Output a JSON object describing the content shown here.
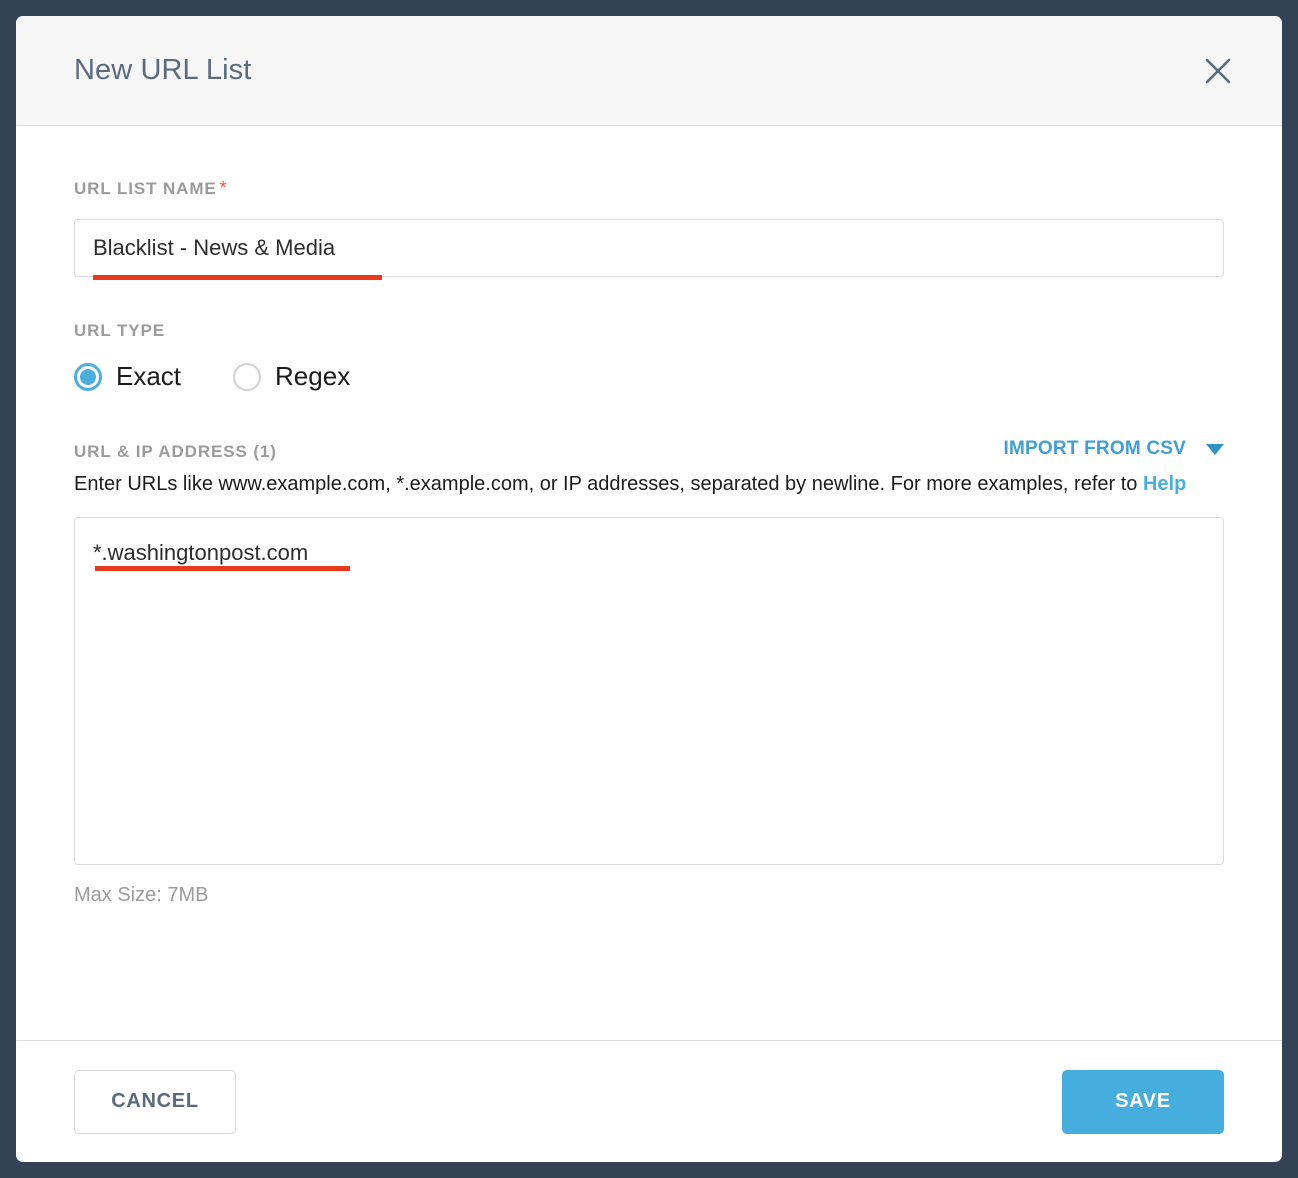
{
  "modal": {
    "title": "New URL List",
    "close_icon": "close-icon"
  },
  "form": {
    "name_field": {
      "label": "URL LIST NAME",
      "required_marker": "*",
      "value": "Blacklist - News & Media",
      "placeholder": ""
    },
    "url_type": {
      "label": "URL TYPE",
      "options": [
        {
          "label": "Exact",
          "selected": true
        },
        {
          "label": "Regex",
          "selected": false
        }
      ]
    },
    "url_ip": {
      "label": "URL & IP ADDRESS (1)",
      "import_label": "IMPORT FROM CSV",
      "import_caret_icon": "chevron-down-icon",
      "helper_text_before": "Enter URLs like www.example.com, *.example.com, or IP addresses, separated by newline. For more examples, refer to ",
      "help_link": "Help",
      "textarea_value": "*.washingtonpost.com",
      "textarea_placeholder": "",
      "max_size": "Max Size: 7MB"
    }
  },
  "footer": {
    "cancel_label": "CANCEL",
    "save_label": "SAVE"
  },
  "colors": {
    "backdrop": "#344256",
    "accent_blue": "#45aede",
    "link_blue": "#4aaede",
    "annotation_red": "#e8391f",
    "required_red": "#f4553c",
    "label_gray": "#9b9b9b",
    "title_slate": "#5b6b7f"
  }
}
